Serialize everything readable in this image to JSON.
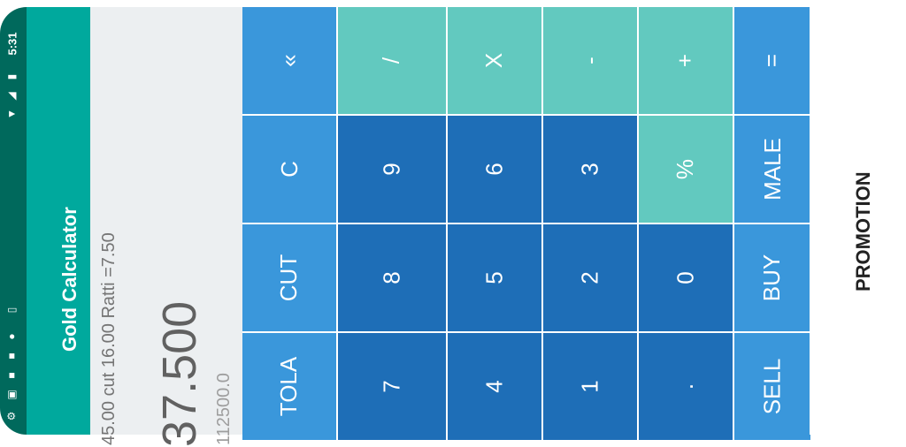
{
  "status_bar": {
    "time": "5:31",
    "icons": [
      "wifi-icon",
      "signal-icon",
      "battery-icon",
      "settings-icon",
      "notification-icon",
      "notification-icon",
      "circle-icon",
      "sim-icon"
    ]
  },
  "app_bar": {
    "title": "Gold Calculator"
  },
  "display": {
    "expression": "45.00 cut 16.00 Ratti =7.50",
    "result": "37.500",
    "secondary": "112500.0"
  },
  "keypad": {
    "rows": [
      [
        {
          "label": "«",
          "kind": "fn",
          "name": "backspace-button"
        },
        {
          "label": "/",
          "kind": "op",
          "name": "divide-button"
        },
        {
          "label": "X",
          "kind": "op",
          "name": "multiply-button"
        },
        {
          "label": "-",
          "kind": "op",
          "name": "subtract-button"
        },
        {
          "label": "+",
          "kind": "op",
          "name": "add-button"
        },
        {
          "label": "=",
          "kind": "fn",
          "name": "equals-button"
        }
      ],
      [
        {
          "label": "C",
          "kind": "fn",
          "name": "clear-button"
        },
        {
          "label": "9",
          "kind": "num",
          "name": "digit-9-button"
        },
        {
          "label": "6",
          "kind": "num",
          "name": "digit-6-button"
        },
        {
          "label": "3",
          "kind": "num",
          "name": "digit-3-button"
        },
        {
          "label": "%",
          "kind": "op",
          "name": "percent-button"
        },
        {
          "label": "MALE",
          "kind": "fn",
          "name": "male-button"
        }
      ],
      [
        {
          "label": "CUT",
          "kind": "fn",
          "name": "cut-button"
        },
        {
          "label": "8",
          "kind": "num",
          "name": "digit-8-button"
        },
        {
          "label": "5",
          "kind": "num",
          "name": "digit-5-button"
        },
        {
          "label": "2",
          "kind": "num",
          "name": "digit-2-button"
        },
        {
          "label": "0",
          "kind": "num",
          "name": "digit-0-button"
        },
        {
          "label": "BUY",
          "kind": "fn",
          "name": "buy-button"
        }
      ],
      [
        {
          "label": "TOLA",
          "kind": "fn",
          "name": "tola-button"
        },
        {
          "label": "7",
          "kind": "num",
          "name": "digit-7-button"
        },
        {
          "label": "4",
          "kind": "num",
          "name": "digit-4-button"
        },
        {
          "label": "1",
          "kind": "num",
          "name": "digit-1-button"
        },
        {
          "label": ".",
          "kind": "num",
          "name": "decimal-button"
        },
        {
          "label": "SELL",
          "kind": "fn",
          "name": "sell-button"
        }
      ]
    ]
  },
  "promotion": {
    "label": "PROMOTION"
  },
  "colors": {
    "status_bar": "#00695c",
    "app_bar": "#00a99d",
    "operator": "#62c9bf",
    "digit": "#1e6eb7",
    "function": "#3a97db"
  }
}
